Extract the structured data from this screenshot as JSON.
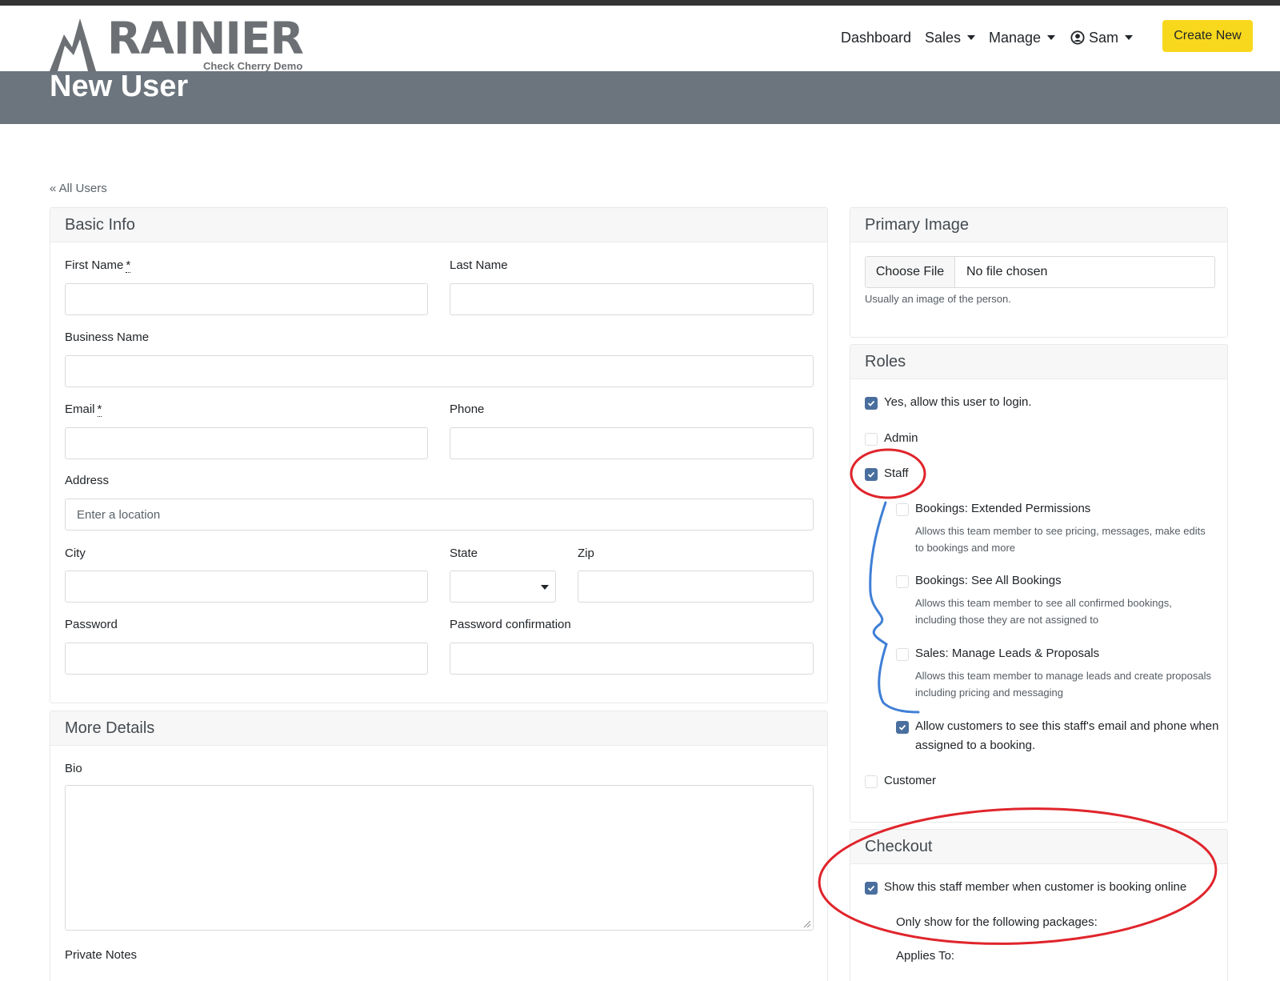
{
  "app": {
    "logo_text": "RAINIER",
    "logo_subtitle": "Check Cherry Demo"
  },
  "nav": {
    "dashboard": "Dashboard",
    "sales": "Sales",
    "manage": "Manage",
    "user": "Sam",
    "create_new": "Create New"
  },
  "page": {
    "title": "New User",
    "back_link": "« All Users"
  },
  "basic_info": {
    "header": "Basic Info",
    "first_name_label": "First Name",
    "last_name_label": "Last Name",
    "business_name_label": "Business Name",
    "email_label": "Email",
    "phone_label": "Phone",
    "address_label": "Address",
    "address_placeholder": "Enter a location",
    "city_label": "City",
    "state_label": "State",
    "zip_label": "Zip",
    "password_label": "Password",
    "password_confirmation_label": "Password confirmation",
    "required_marker": "*"
  },
  "more_details": {
    "header": "More Details",
    "bio_label": "Bio",
    "private_notes_label": "Private Notes"
  },
  "primary_image": {
    "header": "Primary Image",
    "choose_file": "Choose File",
    "no_file": "No file chosen",
    "help": "Usually an image of the person."
  },
  "roles": {
    "header": "Roles",
    "allow_login": {
      "label": "Yes, allow this user to login.",
      "checked": true
    },
    "admin": {
      "label": "Admin",
      "checked": false
    },
    "staff": {
      "label": "Staff",
      "checked": true
    },
    "ext_permissions": {
      "label": "Bookings: Extended Permissions",
      "help": "Allows this team member to see pricing, messages, make edits to bookings and more",
      "checked": false
    },
    "see_all": {
      "label": "Bookings: See All Bookings",
      "help": "Allows this team member to see all confirmed bookings, including those they are not assigned to",
      "checked": false
    },
    "leads": {
      "label": "Sales: Manage Leads & Proposals",
      "help": "Allows this team member to manage leads and create proposals including pricing and messaging",
      "checked": false
    },
    "contact_visible": {
      "label": "Allow customers to see this staff's email and phone when assigned to a booking.",
      "checked": true
    },
    "customer": {
      "label": "Customer",
      "checked": false
    }
  },
  "checkout": {
    "header": "Checkout",
    "show_staff": {
      "label": "Show this staff member when customer is booking online",
      "checked": true
    },
    "only_show": "Only show for the following packages:",
    "applies_to": "Applies To:"
  },
  "colors": {
    "banner": "#6c757d",
    "accent_button": "#f8d81c",
    "checkbox": "#4a6f9e",
    "annotation_red": "#e0242b",
    "annotation_blue": "#3f7fd6"
  }
}
